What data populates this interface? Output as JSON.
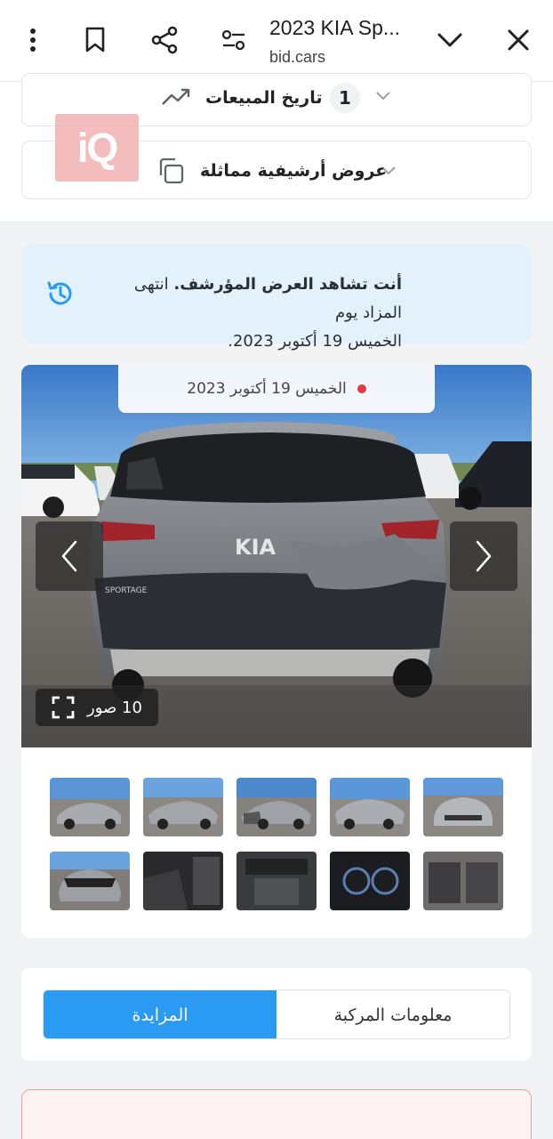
{
  "browser": {
    "title": "2023 KIA Sp...",
    "url": "bid.cars",
    "icons": [
      "more-vert-icon",
      "bookmark-icon",
      "share-icon",
      "tune-icon",
      "chevron-down-icon",
      "close-icon"
    ]
  },
  "sections": {
    "sales_history": {
      "label": "تاريخ المبيعات",
      "count": "1",
      "icon": "trending-up-icon"
    },
    "similar_archive": {
      "label": "عروض أرشيفية مماثلة",
      "icon": "copy-icon"
    }
  },
  "watermark": {
    "text": "iQ",
    "color": "#f3b6b6"
  },
  "archive_notice": {
    "bold": "أنت تشاهد العرض المؤرشف.",
    "rest": "انتهى المزاد يوم",
    "date": "الخميس 19 أكتوبر 2023."
  },
  "gallery": {
    "date_label": "الخميس 19 أكتوبر 2023",
    "photos_count_label": "10 صور",
    "thumbnail_count": 10
  },
  "tabs": {
    "active": "المزايدة",
    "inactive": "معلومات المركبة"
  },
  "colors": {
    "accent": "#2b9af3",
    "info_bg": "#e3f1fb",
    "status_dot": "#e0393e"
  }
}
